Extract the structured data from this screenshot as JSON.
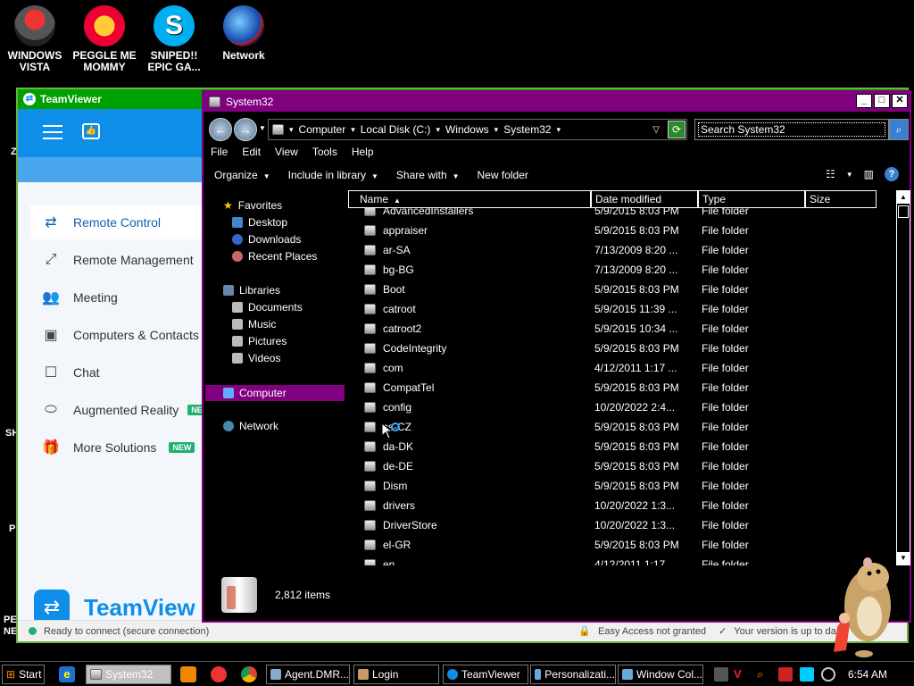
{
  "desktop": {
    "icons": [
      {
        "label": "WINDOWS VISTA"
      },
      {
        "label": "PEGGLE ME MOMMY"
      },
      {
        "label": "SNIPED!! EPIC GA..."
      },
      {
        "label": "Network"
      }
    ],
    "edge_left": [
      "Z",
      "SH",
      "P",
      "PE",
      "NE"
    ]
  },
  "teamviewer": {
    "title": "TeamViewer",
    "nav": [
      {
        "label": "Remote Control",
        "icon": "arrows-icon"
      },
      {
        "label": "Remote Management",
        "icon": "expand-icon"
      },
      {
        "label": "Meeting",
        "icon": "people-icon"
      },
      {
        "label": "Computers & Contacts",
        "icon": "contacts-icon"
      },
      {
        "label": "Chat",
        "icon": "chat-icon"
      },
      {
        "label": "Augmented Reality",
        "icon": "ar-icon",
        "badge": "NE"
      },
      {
        "label": "More Solutions",
        "icon": "gift-icon",
        "badge": "NEW"
      }
    ],
    "brand": "TeamView",
    "status": "Ready to connect (secure connection)",
    "easy_access": "Easy Access not granted",
    "version": "Your version is up to da"
  },
  "explorer": {
    "title": "System32",
    "address": [
      "Computer",
      "Local Disk (C:)",
      "Windows",
      "System32"
    ],
    "search_placeholder": "Search System32",
    "menu": [
      "File",
      "Edit",
      "View",
      "Tools",
      "Help"
    ],
    "toolbar": {
      "organize": "Organize",
      "include": "Include in library",
      "share": "Share with",
      "newfolder": "New folder"
    },
    "nav": {
      "favorites": "Favorites",
      "desktop": "Desktop",
      "downloads": "Downloads",
      "recent": "Recent Places",
      "libraries": "Libraries",
      "documents": "Documents",
      "music": "Music",
      "pictures": "Pictures",
      "videos": "Videos",
      "computer": "Computer",
      "network": "Network"
    },
    "columns": {
      "name": "Name",
      "date": "Date modified",
      "type": "Type",
      "size": "Size"
    },
    "rows": [
      {
        "name": "AdvancedInstallers",
        "date": "5/9/2015 8:03 PM",
        "type": "File folder"
      },
      {
        "name": "appraiser",
        "date": "5/9/2015 8:03 PM",
        "type": "File folder"
      },
      {
        "name": "ar-SA",
        "date": "7/13/2009 8:20 ...",
        "type": "File folder"
      },
      {
        "name": "bg-BG",
        "date": "7/13/2009 8:20 ...",
        "type": "File folder"
      },
      {
        "name": "Boot",
        "date": "5/9/2015 8:03 PM",
        "type": "File folder"
      },
      {
        "name": "catroot",
        "date": "5/9/2015 11:39 ...",
        "type": "File folder"
      },
      {
        "name": "catroot2",
        "date": "5/9/2015 10:34 ...",
        "type": "File folder"
      },
      {
        "name": "CodeIntegrity",
        "date": "5/9/2015 8:03 PM",
        "type": "File folder"
      },
      {
        "name": "com",
        "date": "4/12/2011 1:17 ...",
        "type": "File folder"
      },
      {
        "name": "CompatTel",
        "date": "5/9/2015 8:03 PM",
        "type": "File folder"
      },
      {
        "name": "config",
        "date": "10/20/2022 2:4...",
        "type": "File folder"
      },
      {
        "name": "cs-CZ",
        "date": "5/9/2015 8:03 PM",
        "type": "File folder"
      },
      {
        "name": "da-DK",
        "date": "5/9/2015 8:03 PM",
        "type": "File folder"
      },
      {
        "name": "de-DE",
        "date": "5/9/2015 8:03 PM",
        "type": "File folder"
      },
      {
        "name": "Dism",
        "date": "5/9/2015 8:03 PM",
        "type": "File folder"
      },
      {
        "name": "drivers",
        "date": "10/20/2022 1:3...",
        "type": "File folder"
      },
      {
        "name": "DriverStore",
        "date": "10/20/2022 1:3...",
        "type": "File folder"
      },
      {
        "name": "el-GR",
        "date": "5/9/2015 8:03 PM",
        "type": "File folder"
      },
      {
        "name": "en",
        "date": "4/12/2011 1:17 ...",
        "type": "File folder"
      }
    ],
    "item_count": "2,812 items"
  },
  "taskbar": {
    "start": "Start",
    "items": [
      "System32",
      "Agent.DMR...",
      "Login",
      "TeamViewer",
      "Personalizati...",
      "Window Col..."
    ],
    "clock": "6:54 AM"
  },
  "colors": {
    "accent": "#800080",
    "teamviewer_blue": "#0e8ee9",
    "tv_title": "#00a000"
  }
}
